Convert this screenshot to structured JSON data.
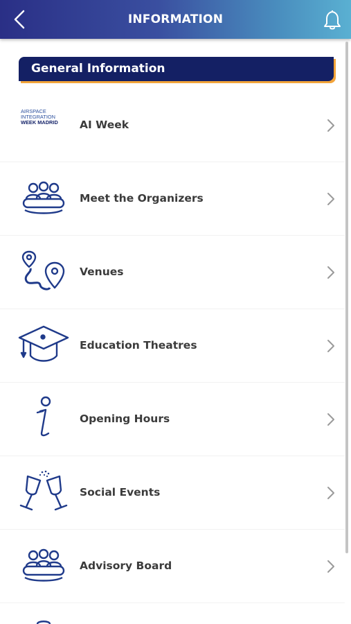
{
  "header": {
    "title": "INFORMATION"
  },
  "section": {
    "title": "General Information"
  },
  "items": [
    {
      "label": "AI Week",
      "icon": "event-logo-icon",
      "logo_lines": [
        "AIRSPACE",
        "INTEGRATION",
        "WEEK MADRID"
      ]
    },
    {
      "label": "Meet the Organizers",
      "icon": "group-icon"
    },
    {
      "label": "Venues",
      "icon": "map-route-icon"
    },
    {
      "label": "Education Theatres",
      "icon": "graduation-cap-icon"
    },
    {
      "label": "Opening Hours",
      "icon": "info-icon"
    },
    {
      "label": "Social Events",
      "icon": "champagne-toast-icon"
    },
    {
      "label": "Advisory Board",
      "icon": "group-icon"
    }
  ],
  "colors": {
    "header_start": "#2a2f86",
    "header_end": "#5ab0d2",
    "section_bg": "#142064",
    "section_accent": "#f2a43a",
    "icon_blue": "#1f3a8a"
  }
}
